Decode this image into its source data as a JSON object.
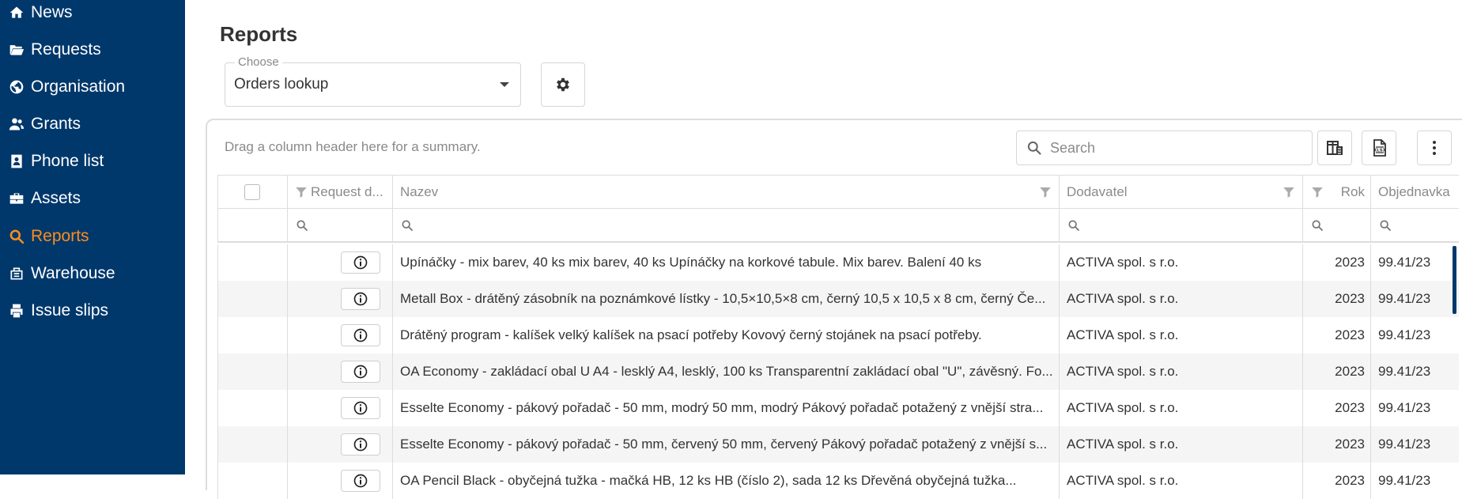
{
  "sidebar": {
    "items": [
      {
        "label": "News",
        "icon": "home-icon"
      },
      {
        "label": "Requests",
        "icon": "folder-open-icon"
      },
      {
        "label": "Organisation",
        "icon": "globe-icon"
      },
      {
        "label": "Grants",
        "icon": "users-icon"
      },
      {
        "label": "Phone list",
        "icon": "address-book-icon"
      },
      {
        "label": "Assets",
        "icon": "briefcase-icon"
      },
      {
        "label": "Reports",
        "icon": "search-icon",
        "active": true
      },
      {
        "label": "Warehouse",
        "icon": "warehouse-icon"
      },
      {
        "label": "Issue slips",
        "icon": "printer-icon"
      }
    ]
  },
  "main": {
    "title": "Reports",
    "choose": {
      "label": "Choose",
      "value": "Orders lookup"
    },
    "group_hint": "Drag a column header here for a summary.",
    "search": {
      "placeholder": "Search"
    }
  },
  "grid": {
    "columns": [
      "Request d...",
      "Nazev",
      "Dodavatel",
      "Rok",
      "Objednavka"
    ],
    "rows": [
      {
        "nazev": "Upínáčky - mix barev, 40 ks mix barev, 40 ks Upínáčky na korkové tabule. Mix barev. Balení 40 ks",
        "dodavatel": "ACTIVA spol. s r.o.",
        "rok": "2023",
        "objednavka": "99.41/23"
      },
      {
        "nazev": "Metall Box - drátěný zásobník na poznámkové lístky - 10,5×10,5×8 cm, černý 10,5 x 10,5 x 8 cm, černý Če...",
        "dodavatel": "ACTIVA spol. s r.o.",
        "rok": "2023",
        "objednavka": "99.41/23"
      },
      {
        "nazev": "Drátěný program - kalíšek velký kalíšek na psací potřeby Kovový černý stojánek na psací potřeby.",
        "dodavatel": "ACTIVA spol. s r.o.",
        "rok": "2023",
        "objednavka": "99.41/23"
      },
      {
        "nazev": "OA Economy - zakládací obal U A4 - lesklý A4, lesklý, 100 ks Transparentní zakládací obal \"U\", závěsný. Fo...",
        "dodavatel": "ACTIVA spol. s r.o.",
        "rok": "2023",
        "objednavka": "99.41/23"
      },
      {
        "nazev": "Esselte Economy - pákový pořadač - 50 mm, modrý 50 mm, modrý Pákový pořadač potažený z vnější stra...",
        "dodavatel": "ACTIVA spol. s r.o.",
        "rok": "2023",
        "objednavka": "99.41/23"
      },
      {
        "nazev": "Esselte Economy - pákový pořadač - 50 mm, červený 50 mm, červený Pákový pořadač potažený z vnější s...",
        "dodavatel": "ACTIVA spol. s r.o.",
        "rok": "2023",
        "objednavka": "99.41/23"
      },
      {
        "nazev": "OA Pencil Black - obyčejná tužka - mačká HB, 12 ks HB (číslo 2), sada 12 ks Dřevěná obyčejná tužka...",
        "dodavatel": "ACTIVA spol. s r.o.",
        "rok": "2023",
        "objednavka": "99.41/23"
      }
    ]
  },
  "colors": {
    "sidebar_bg": "#00386c",
    "active": "#ff8d1a"
  }
}
